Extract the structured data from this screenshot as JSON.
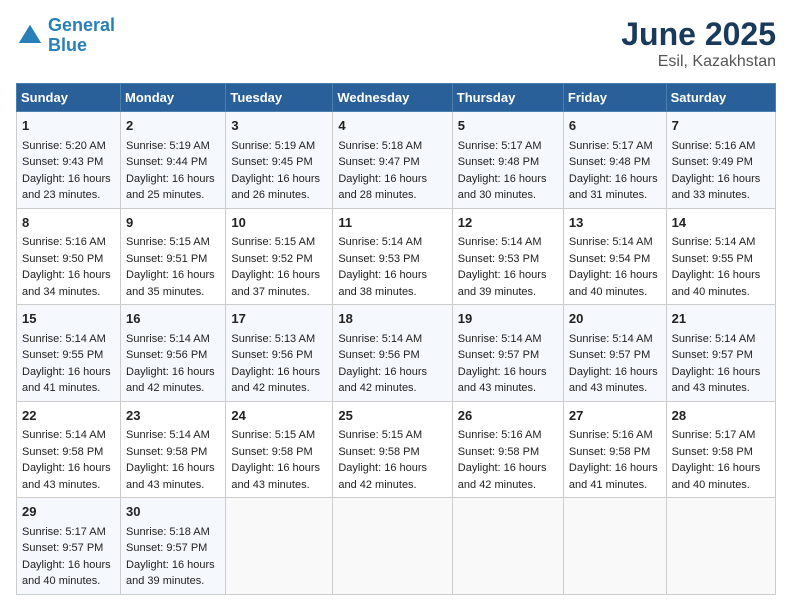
{
  "header": {
    "logo_line1": "General",
    "logo_line2": "Blue",
    "title": "June 2025",
    "subtitle": "Esil, Kazakhstan"
  },
  "days_of_week": [
    "Sunday",
    "Monday",
    "Tuesday",
    "Wednesday",
    "Thursday",
    "Friday",
    "Saturday"
  ],
  "weeks": [
    [
      {
        "day": "1",
        "sunrise": "Sunrise: 5:20 AM",
        "sunset": "Sunset: 9:43 PM",
        "daylight": "Daylight: 16 hours and 23 minutes."
      },
      {
        "day": "2",
        "sunrise": "Sunrise: 5:19 AM",
        "sunset": "Sunset: 9:44 PM",
        "daylight": "Daylight: 16 hours and 25 minutes."
      },
      {
        "day": "3",
        "sunrise": "Sunrise: 5:19 AM",
        "sunset": "Sunset: 9:45 PM",
        "daylight": "Daylight: 16 hours and 26 minutes."
      },
      {
        "day": "4",
        "sunrise": "Sunrise: 5:18 AM",
        "sunset": "Sunset: 9:47 PM",
        "daylight": "Daylight: 16 hours and 28 minutes."
      },
      {
        "day": "5",
        "sunrise": "Sunrise: 5:17 AM",
        "sunset": "Sunset: 9:48 PM",
        "daylight": "Daylight: 16 hours and 30 minutes."
      },
      {
        "day": "6",
        "sunrise": "Sunrise: 5:17 AM",
        "sunset": "Sunset: 9:48 PM",
        "daylight": "Daylight: 16 hours and 31 minutes."
      },
      {
        "day": "7",
        "sunrise": "Sunrise: 5:16 AM",
        "sunset": "Sunset: 9:49 PM",
        "daylight": "Daylight: 16 hours and 33 minutes."
      }
    ],
    [
      {
        "day": "8",
        "sunrise": "Sunrise: 5:16 AM",
        "sunset": "Sunset: 9:50 PM",
        "daylight": "Daylight: 16 hours and 34 minutes."
      },
      {
        "day": "9",
        "sunrise": "Sunrise: 5:15 AM",
        "sunset": "Sunset: 9:51 PM",
        "daylight": "Daylight: 16 hours and 35 minutes."
      },
      {
        "day": "10",
        "sunrise": "Sunrise: 5:15 AM",
        "sunset": "Sunset: 9:52 PM",
        "daylight": "Daylight: 16 hours and 37 minutes."
      },
      {
        "day": "11",
        "sunrise": "Sunrise: 5:14 AM",
        "sunset": "Sunset: 9:53 PM",
        "daylight": "Daylight: 16 hours and 38 minutes."
      },
      {
        "day": "12",
        "sunrise": "Sunrise: 5:14 AM",
        "sunset": "Sunset: 9:53 PM",
        "daylight": "Daylight: 16 hours and 39 minutes."
      },
      {
        "day": "13",
        "sunrise": "Sunrise: 5:14 AM",
        "sunset": "Sunset: 9:54 PM",
        "daylight": "Daylight: 16 hours and 40 minutes."
      },
      {
        "day": "14",
        "sunrise": "Sunrise: 5:14 AM",
        "sunset": "Sunset: 9:55 PM",
        "daylight": "Daylight: 16 hours and 40 minutes."
      }
    ],
    [
      {
        "day": "15",
        "sunrise": "Sunrise: 5:14 AM",
        "sunset": "Sunset: 9:55 PM",
        "daylight": "Daylight: 16 hours and 41 minutes."
      },
      {
        "day": "16",
        "sunrise": "Sunrise: 5:14 AM",
        "sunset": "Sunset: 9:56 PM",
        "daylight": "Daylight: 16 hours and 42 minutes."
      },
      {
        "day": "17",
        "sunrise": "Sunrise: 5:13 AM",
        "sunset": "Sunset: 9:56 PM",
        "daylight": "Daylight: 16 hours and 42 minutes."
      },
      {
        "day": "18",
        "sunrise": "Sunrise: 5:14 AM",
        "sunset": "Sunset: 9:56 PM",
        "daylight": "Daylight: 16 hours and 42 minutes."
      },
      {
        "day": "19",
        "sunrise": "Sunrise: 5:14 AM",
        "sunset": "Sunset: 9:57 PM",
        "daylight": "Daylight: 16 hours and 43 minutes."
      },
      {
        "day": "20",
        "sunrise": "Sunrise: 5:14 AM",
        "sunset": "Sunset: 9:57 PM",
        "daylight": "Daylight: 16 hours and 43 minutes."
      },
      {
        "day": "21",
        "sunrise": "Sunrise: 5:14 AM",
        "sunset": "Sunset: 9:57 PM",
        "daylight": "Daylight: 16 hours and 43 minutes."
      }
    ],
    [
      {
        "day": "22",
        "sunrise": "Sunrise: 5:14 AM",
        "sunset": "Sunset: 9:58 PM",
        "daylight": "Daylight: 16 hours and 43 minutes."
      },
      {
        "day": "23",
        "sunrise": "Sunrise: 5:14 AM",
        "sunset": "Sunset: 9:58 PM",
        "daylight": "Daylight: 16 hours and 43 minutes."
      },
      {
        "day": "24",
        "sunrise": "Sunrise: 5:15 AM",
        "sunset": "Sunset: 9:58 PM",
        "daylight": "Daylight: 16 hours and 43 minutes."
      },
      {
        "day": "25",
        "sunrise": "Sunrise: 5:15 AM",
        "sunset": "Sunset: 9:58 PM",
        "daylight": "Daylight: 16 hours and 42 minutes."
      },
      {
        "day": "26",
        "sunrise": "Sunrise: 5:16 AM",
        "sunset": "Sunset: 9:58 PM",
        "daylight": "Daylight: 16 hours and 42 minutes."
      },
      {
        "day": "27",
        "sunrise": "Sunrise: 5:16 AM",
        "sunset": "Sunset: 9:58 PM",
        "daylight": "Daylight: 16 hours and 41 minutes."
      },
      {
        "day": "28",
        "sunrise": "Sunrise: 5:17 AM",
        "sunset": "Sunset: 9:58 PM",
        "daylight": "Daylight: 16 hours and 40 minutes."
      }
    ],
    [
      {
        "day": "29",
        "sunrise": "Sunrise: 5:17 AM",
        "sunset": "Sunset: 9:57 PM",
        "daylight": "Daylight: 16 hours and 40 minutes."
      },
      {
        "day": "30",
        "sunrise": "Sunrise: 5:18 AM",
        "sunset": "Sunset: 9:57 PM",
        "daylight": "Daylight: 16 hours and 39 minutes."
      },
      null,
      null,
      null,
      null,
      null
    ]
  ]
}
